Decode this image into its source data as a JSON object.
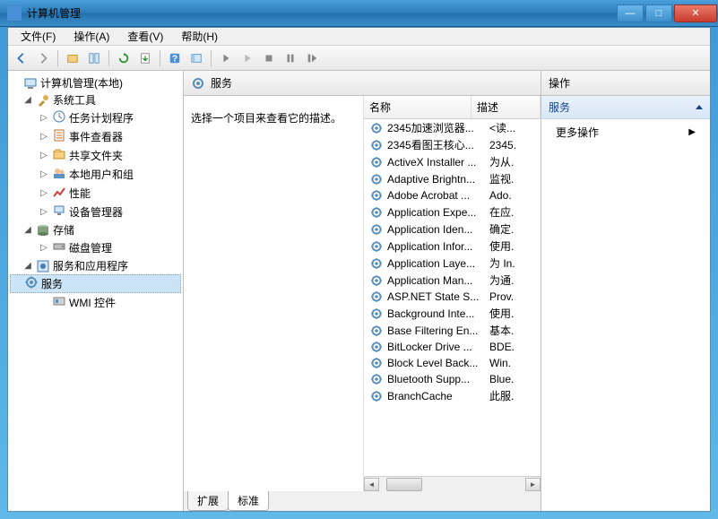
{
  "window": {
    "title": "计算机管理"
  },
  "menubar": [
    "文件(F)",
    "操作(A)",
    "查看(V)",
    "帮助(H)"
  ],
  "tree": {
    "root": "计算机管理(本地)",
    "groups": [
      {
        "label": "系统工具",
        "expanded": true,
        "children": [
          "任务计划程序",
          "事件查看器",
          "共享文件夹",
          "本地用户和组",
          "性能",
          "设备管理器"
        ]
      },
      {
        "label": "存储",
        "expanded": true,
        "children": [
          "磁盘管理"
        ]
      },
      {
        "label": "服务和应用程序",
        "expanded": true,
        "children": [
          "服务",
          "WMI 控件"
        ],
        "selected": "服务"
      }
    ]
  },
  "center": {
    "header": "服务",
    "description_prompt": "选择一个项目来查看它的描述。",
    "columns": {
      "name": "名称",
      "desc": "描述"
    },
    "services": [
      {
        "name": "2345加速浏览器...",
        "desc": "<读..."
      },
      {
        "name": "2345看图王核心...",
        "desc": "2345."
      },
      {
        "name": "ActiveX Installer ...",
        "desc": "为从."
      },
      {
        "name": "Adaptive Brightn...",
        "desc": "监视."
      },
      {
        "name": "Adobe Acrobat ...",
        "desc": "Ado."
      },
      {
        "name": "Application Expe...",
        "desc": "在应."
      },
      {
        "name": "Application Iden...",
        "desc": "确定."
      },
      {
        "name": "Application Infor...",
        "desc": "使用."
      },
      {
        "name": "Application Laye...",
        "desc": "为 In."
      },
      {
        "name": "Application Man...",
        "desc": "为通."
      },
      {
        "name": "ASP.NET State S...",
        "desc": "Prov."
      },
      {
        "name": "Background Inte...",
        "desc": "使用."
      },
      {
        "name": "Base Filtering En...",
        "desc": "基本."
      },
      {
        "name": "BitLocker Drive ...",
        "desc": "BDE."
      },
      {
        "name": "Block Level Back...",
        "desc": "Win."
      },
      {
        "name": "Bluetooth Supp...",
        "desc": "Blue."
      },
      {
        "name": "BranchCache",
        "desc": "此服."
      }
    ],
    "tabs": {
      "extended": "扩展",
      "standard": "标准"
    }
  },
  "actions": {
    "header": "操作",
    "section": "服务",
    "more": "更多操作"
  }
}
